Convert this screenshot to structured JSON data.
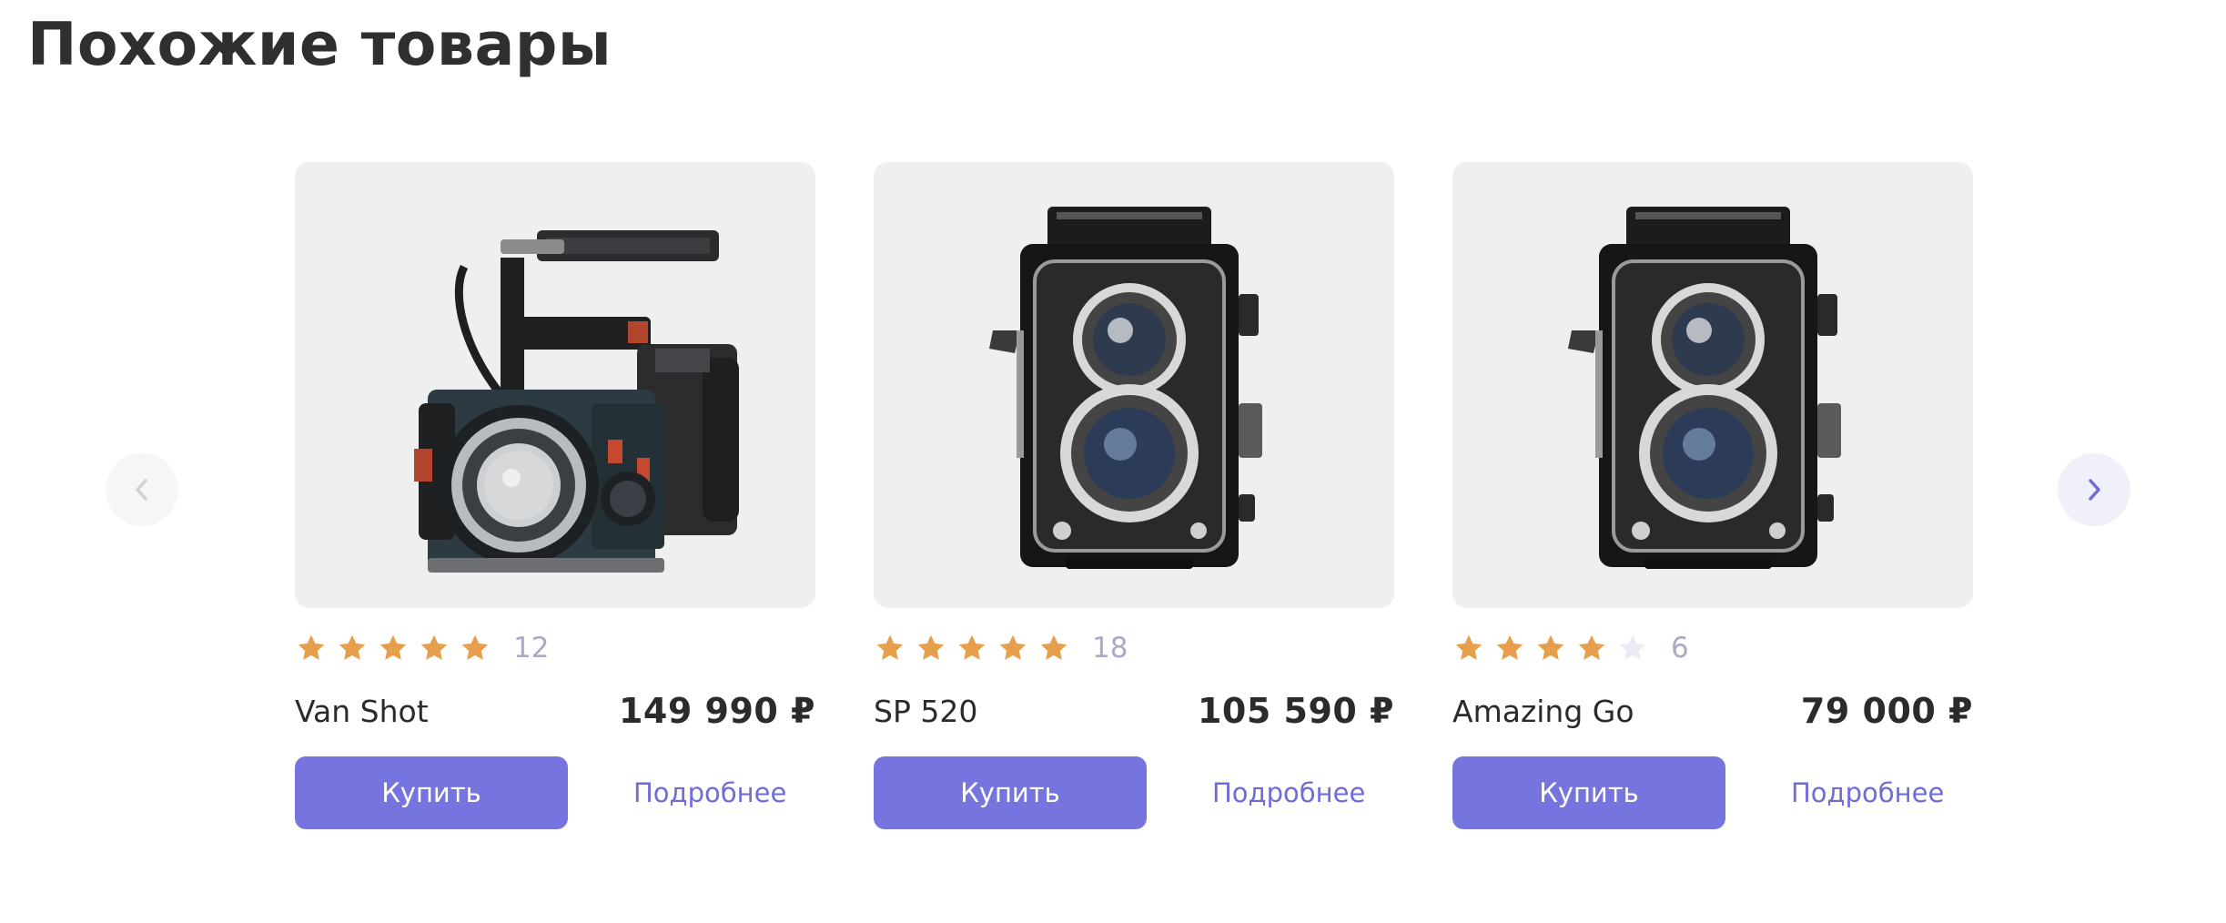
{
  "section": {
    "title": "Похожие товары"
  },
  "colors": {
    "accent": "#7674de",
    "star_filled": "#e89f4b",
    "star_empty": "#ebebf5",
    "image_background": "#efefef"
  },
  "carousel": {
    "prev_icon": "chevron-left-icon",
    "next_icon": "chevron-right-icon"
  },
  "products": [
    {
      "name": "Van Shot",
      "price": "149 990 ₽",
      "rating": 5,
      "max_rating": 5,
      "reviews": "12",
      "image": "cinema-camera",
      "buy_label": "Купить",
      "details_label": "Подробнее"
    },
    {
      "name": "SP 520",
      "price": "105 590 ₽",
      "rating": 5,
      "max_rating": 5,
      "reviews": "18",
      "image": "twin-lens-camera",
      "buy_label": "Купить",
      "details_label": "Подробнее"
    },
    {
      "name": "Amazing Go",
      "price": "79 000 ₽",
      "rating": 4,
      "max_rating": 5,
      "reviews": "6",
      "image": "twin-lens-camera",
      "buy_label": "Купить",
      "details_label": "Подробнее"
    }
  ]
}
